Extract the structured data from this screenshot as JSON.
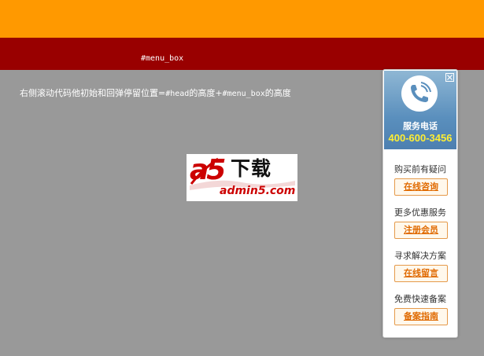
{
  "menu_box": {
    "label": "#menu_box"
  },
  "description": {
    "part1": "右侧滚动代码",
    "part2": "他初始和回弹停留位置=",
    "code1": "#head",
    "part3": "的高度+",
    "code2": "#menu_box",
    "part4": "的高度"
  },
  "logo": {
    "a5": "a5",
    "xiazai": "下载",
    "domain": "admin5.com"
  },
  "service_panel": {
    "service_label": "服务电话",
    "phone_number": "400-600-3456",
    "items": [
      {
        "question": "购买前有疑问",
        "button": "在线咨询"
      },
      {
        "question": "更多优惠服务",
        "button": "注册会员"
      },
      {
        "question": "寻求解决方案",
        "button": "在线留言"
      },
      {
        "question": "免费快速备案",
        "button": "备案指南"
      }
    ]
  },
  "colors": {
    "head": "#ff9900",
    "menu_box": "#990000",
    "body": "#999999",
    "accent_orange": "#e06a00",
    "phone_yellow": "#ffee33",
    "panel_blue": "#5a8fbd"
  }
}
